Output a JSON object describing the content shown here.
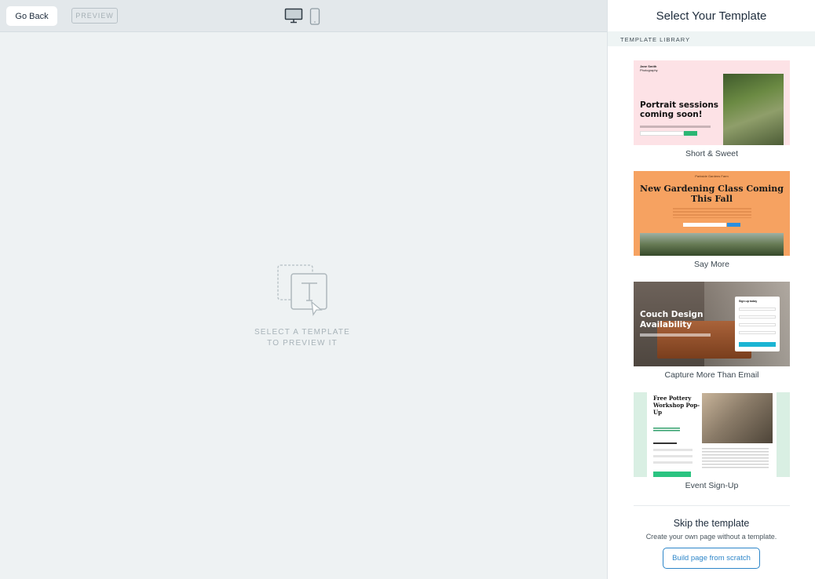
{
  "toolbar": {
    "go_back_label": "Go Back",
    "preview_label": "PREVIEW",
    "device_icons": [
      "desktop-icon",
      "mobile-icon"
    ]
  },
  "empty_state": {
    "icon": "template-placeholder-icon",
    "line1": "SELECT A TEMPLATE",
    "line2": "TO PREVIEW IT"
  },
  "panel": {
    "title": "Select Your Template",
    "library_label": "TEMPLATE LIBRARY",
    "templates": [
      {
        "name": "Short & Sweet",
        "thumb": {
          "brand_line1": "Jane Smith",
          "brand_line2": "Photography",
          "headline": "Portrait sessions coming soon!"
        }
      },
      {
        "name": "Say More",
        "thumb": {
          "small": "Parkside Gardens Farm",
          "headline": "New Gardening Class Coming This Fall"
        }
      },
      {
        "name": "Capture More Than Email",
        "thumb": {
          "headline": "Couch Design Availability",
          "form_title": "Sign up today"
        }
      },
      {
        "name": "Event Sign-Up",
        "thumb": {
          "headline": "Free Pottery Workshop Pop-Up"
        }
      }
    ],
    "skip": {
      "title": "Skip the template",
      "subtitle": "Create your own page without a template.",
      "button_label": "Build page from scratch"
    }
  },
  "colors": {
    "accent_blue": "#2d86c9",
    "panel_bg": "#ffffff",
    "editor_bg": "#eef2f3"
  }
}
